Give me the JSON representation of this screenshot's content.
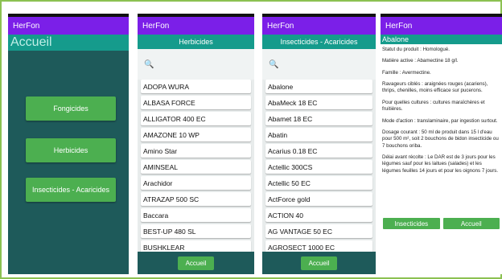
{
  "app_name": "HerFon",
  "screen1": {
    "title": "Accueil",
    "buttons": [
      "Fongicides",
      "Herbicides",
      "Insecticides - Acaricides"
    ]
  },
  "screen2": {
    "header": "Herbicides",
    "search_icon": "🔍",
    "items": [
      "ADOPA WURA",
      "ALBASA FORCE",
      "ALLIGATOR 400 EC",
      "AMAZONE 10 WP",
      "Amino Star",
      "AMINSEAL",
      "Arachidor",
      "ATRAZAP 500 SC",
      "Baccara",
      "BEST-UP 480 SL",
      "BUSHKLEAR"
    ],
    "bottom_button": "Accueil"
  },
  "screen3": {
    "header": "Insecticides - Acaricides",
    "search_icon": "🔍",
    "items": [
      "Abalone",
      "AbaMeck 18 EC",
      "Abamet 18 EC",
      "Abatin",
      "Acarius 0.18 EC",
      "Actellic 300CS",
      "Actellic 50 EC",
      "ActForce gold",
      "ACTION 40",
      "AG VANTAGE 50 EC",
      "AGROSECT 1000 EC"
    ],
    "bottom_button": "Accueil"
  },
  "screen4": {
    "title": "Abalone",
    "paragraphs": [
      "Statut du produit : Homologué.",
      "Matière active : Abamectine 18 g/l.",
      "Famille : Avermectine.",
      "Ravageurs ciblés : araignées rouges (acariens), thrips, chenilles, moins efficace sur pucerons.",
      "Pour quelles cultures : cultures maraîchères et fruitières.",
      "Mode d'action : translaminaire, par ingestion surtout.",
      "Dosage courant : 50 ml de produit dans 15 l d'eau pour 500 m², soit 2 bouchons de bidon insecticide ou 7 bouchons oriba.",
      "Délai avant récolte : Le DAR est de 3 jours pour les légumes sauf pour les laitues (salades) et les légumes feuilles 14 jours et pour les oignons 7 jours."
    ],
    "buttons": [
      "Insecticides",
      "Accueil"
    ]
  },
  "colors": {
    "appbar": "#7b1fe8",
    "subbar": "#159b8c",
    "button": "#4caf50",
    "background_dark": "#1e5a5a"
  }
}
